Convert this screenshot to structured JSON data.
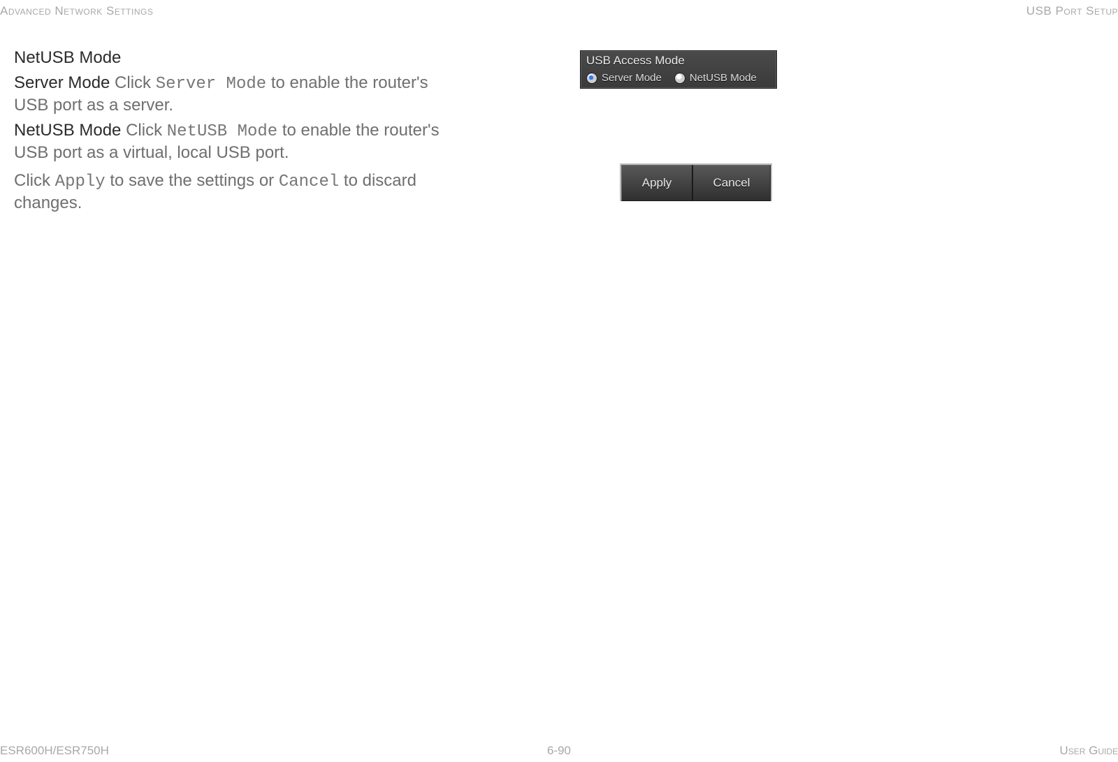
{
  "header": {
    "left": "Advanced Network Settings",
    "right": "USB Port Setup"
  },
  "footer": {
    "left": "ESR600H/ESR750H",
    "center": "6-90",
    "right": "User Guide"
  },
  "body": {
    "title_netusb": "NetUSB Mode",
    "server_label": "Server Mode",
    "server_text_prefix": "  Click ",
    "server_code": "Server Mode",
    "server_text_suffix_1": " to enable the router's ",
    "server_text_suffix_2": "USB port as a server.",
    "netusb_label": "NetUSB Mode",
    "netusb_text_prefix": "  Click ",
    "netusb_code": "NetUSB Mode",
    "netusb_text_suffix_1": " to enable the router's ",
    "netusb_text_suffix_2": "USB port as a virtual, local USB port.",
    "apply_line_prefix": "Click ",
    "apply_code": "Apply",
    "apply_mid": " to save the settings or ",
    "cancel_code": "Cancel",
    "apply_suffix_1": " to discard ",
    "apply_suffix_2": "changes."
  },
  "usb_panel": {
    "title": "USB Access Mode",
    "opt_server": "Server Mode",
    "opt_netusb": "NetUSB Mode"
  },
  "buttons": {
    "apply": "Apply",
    "cancel": "Cancel"
  }
}
